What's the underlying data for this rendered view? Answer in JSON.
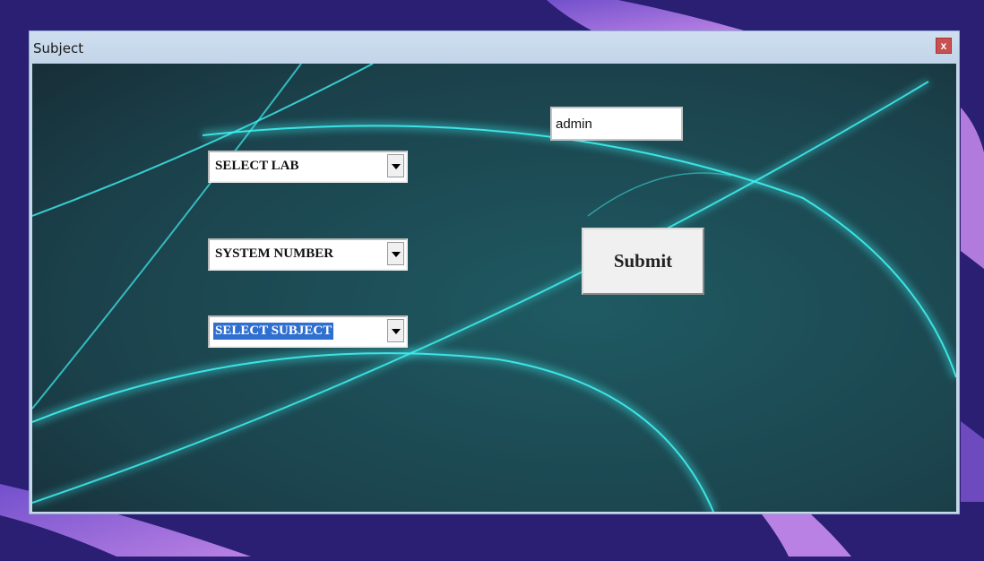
{
  "window": {
    "title": "Subject",
    "close_label": "x"
  },
  "form": {
    "lab_select": {
      "value": "SELECT LAB"
    },
    "system_select": {
      "value": "SYSTEM NUMBER"
    },
    "subject_select": {
      "value": "SELECT SUBJECT",
      "selected": true
    },
    "username": {
      "value": "admin"
    },
    "submit_label": "Submit"
  },
  "colors": {
    "desktop_bg": "#2a1f72",
    "accent_purple": "#b878ea",
    "window_frame": "#c7d8ea",
    "client_bg": "#1c4650",
    "cyan_glow": "#3ff0f0",
    "selection": "#2f6fd0",
    "close_button": "#c75050"
  }
}
